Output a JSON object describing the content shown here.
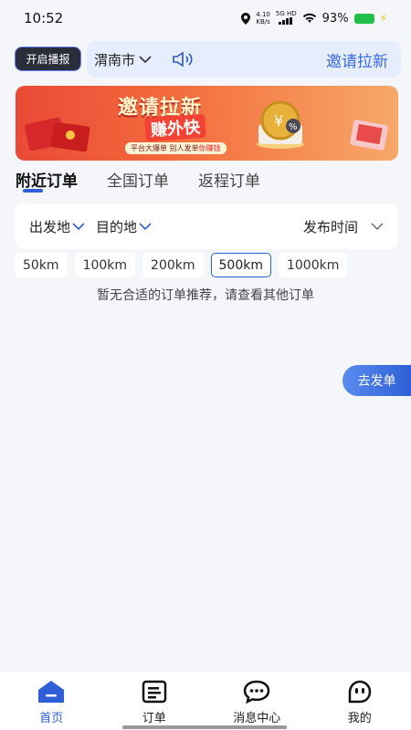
{
  "status_bar": {
    "time": "10:52",
    "net_speed_value": "4.10",
    "net_speed_unit": "KB/s",
    "network": "5G HD",
    "battery_percent": "93%",
    "icons": [
      "location-icon",
      "signal-icon",
      "wifi-icon",
      "battery-icon",
      "charging-icon"
    ]
  },
  "header": {
    "broadcast_button": "开启播报",
    "city": "渭南市",
    "invite_link": "邀请拉新"
  },
  "banner": {
    "title": "邀请拉新",
    "subtitle": "赚外快",
    "footer_part1": "平台大爆单  别人发单",
    "footer_highlight": "你赚钱"
  },
  "tabs": [
    {
      "label": "附近订单",
      "active": true
    },
    {
      "label": "全国订单",
      "active": false
    },
    {
      "label": "返程订单",
      "active": false
    }
  ],
  "filters": {
    "origin": "出发地",
    "destination": "目的地",
    "publish_time": "发布时间"
  },
  "radius_options": [
    {
      "label": "50km",
      "selected": false
    },
    {
      "label": "100km",
      "selected": false
    },
    {
      "label": "200km",
      "selected": false
    },
    {
      "label": "500km",
      "selected": true
    },
    {
      "label": "1000km",
      "selected": false
    }
  ],
  "empty_message": "暂无合适的订单推荐，请查看其他订单",
  "post_order_button": "去发单",
  "bottom_nav": [
    {
      "label": "首页",
      "icon": "home-icon",
      "active": true
    },
    {
      "label": "订单",
      "icon": "order-list-icon",
      "active": false
    },
    {
      "label": "消息中心",
      "icon": "message-icon",
      "active": false
    },
    {
      "label": "我的",
      "icon": "profile-icon",
      "active": false
    }
  ],
  "colors": {
    "accent": "#2f5fd6",
    "background": "#f5f6fa",
    "banner_red": "#e94a35"
  }
}
